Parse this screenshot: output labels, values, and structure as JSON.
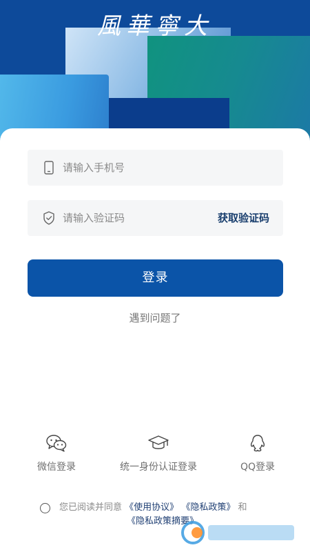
{
  "header": {
    "logo_text": "風華寧大"
  },
  "form": {
    "phone_placeholder": "请输入手机号",
    "code_placeholder": "请输入验证码",
    "get_code_label": "获取验证码",
    "login_label": "登录",
    "trouble_label": "遇到问题了"
  },
  "alt_logins": {
    "wechat_label": "微信登录",
    "identity_label": "统一身份认证登录",
    "qq_label": "QQ登录"
  },
  "agreement": {
    "prefix": "您已阅读并同意",
    "terms_link": "《使用协议》",
    "privacy_link": "《隐私政策》",
    "conjunction": "和",
    "privacy_summary_link": "《隐私政策摘要》"
  },
  "icons": {
    "phone": "phone-icon",
    "shield": "shield-icon",
    "wechat": "wechat-icon",
    "graduation_cap": "graduation-cap-icon",
    "qq": "qq-icon"
  },
  "colors": {
    "brand_blue": "#0b54a8",
    "header_blue": "#0d4a9a",
    "teal": "#10937f",
    "link": "#1f3f73"
  }
}
